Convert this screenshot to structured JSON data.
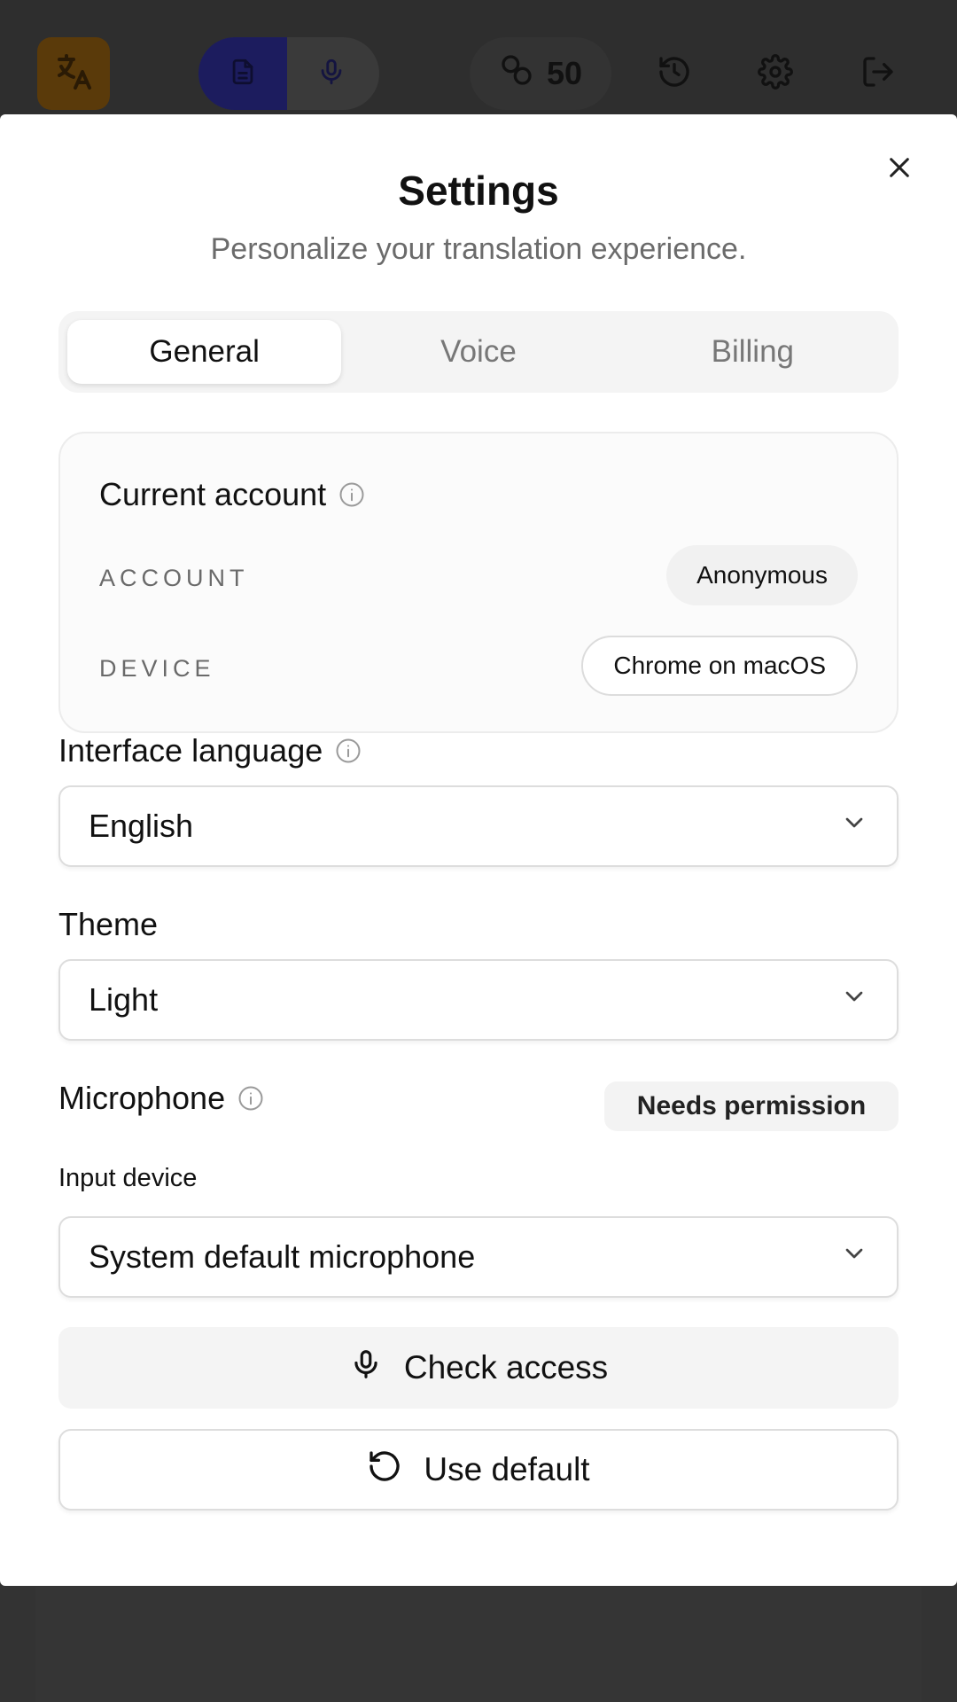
{
  "topbar": {
    "credits_value": "50",
    "icons": [
      "translate-icon",
      "document-icon",
      "microphone-icon",
      "coins-icon",
      "history-icon",
      "gear-icon",
      "logout-icon"
    ]
  },
  "modal": {
    "title": "Settings",
    "subtitle": "Personalize your translation experience.",
    "tabs": [
      {
        "label": "General",
        "active": true
      },
      {
        "label": "Voice",
        "active": false
      },
      {
        "label": "Billing",
        "active": false
      }
    ],
    "account_card": {
      "title": "Current account",
      "account_label": "ACCOUNT",
      "account_value": "Anonymous",
      "device_label": "DEVICE",
      "device_value": "Chrome on macOS"
    },
    "interface_language": {
      "label": "Interface language",
      "value": "English"
    },
    "theme": {
      "label": "Theme",
      "value": "Light"
    },
    "microphone": {
      "label": "Microphone",
      "status": "Needs permission",
      "input_device_label": "Input device",
      "input_device_value": "System default microphone",
      "check_access_label": "Check access",
      "use_default_label": "Use default"
    }
  },
  "colors": {
    "overlay": "#333333",
    "accent_dark": "#1c1c5e",
    "logo_bg": "#5a3a0a",
    "text": "#111111",
    "muted": "#6b6b6b"
  }
}
